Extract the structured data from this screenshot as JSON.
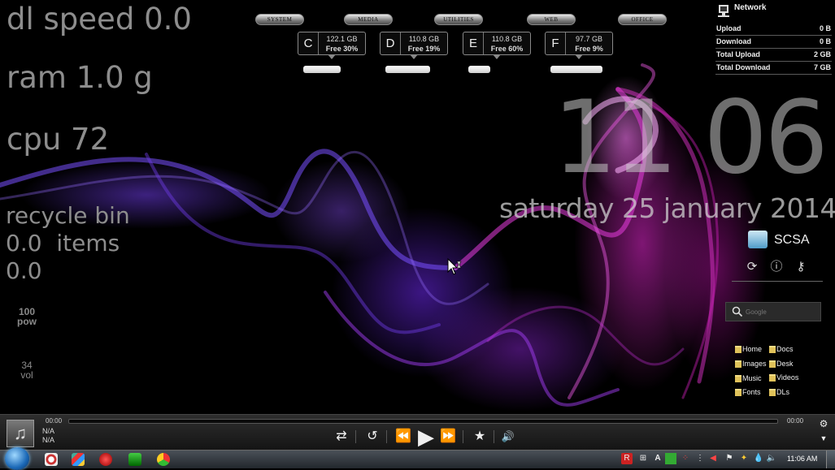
{
  "stats": {
    "dl_speed": "dl speed 0.0",
    "ram": "ram 1.0 g",
    "cpu": "cpu 72",
    "recycle_title": "recycle bin",
    "recycle_items": "0.0  items",
    "recycle_size": "0.0",
    "pow_value": "100",
    "pow_label": "pow",
    "vol_value": "34",
    "vol_label": "vol"
  },
  "tabs": [
    "SYSTEM",
    "MEDIA",
    "UTILITIES",
    "WEB",
    "OFFICE"
  ],
  "drives": [
    {
      "letter": "C",
      "size": "122.1 GB",
      "free": "Free 30%",
      "used_fraction": 0.7
    },
    {
      "letter": "D",
      "size": "110.8 GB",
      "free": "Free 19%",
      "used_fraction": 0.81
    },
    {
      "letter": "E",
      "size": "110.8 GB",
      "free": "Free 60%",
      "used_fraction": 0.4
    },
    {
      "letter": "F",
      "size": "97.7 GB",
      "free": "Free 9%",
      "used_fraction": 0.91
    }
  ],
  "network": {
    "title": "Network",
    "rows": [
      {
        "label": "Upload",
        "value": "0 B"
      },
      {
        "label": "Download",
        "value": "0 B"
      },
      {
        "label": "Total Upload",
        "value": "2 GB"
      },
      {
        "label": "Total Download",
        "value": "7 GB"
      }
    ]
  },
  "clock": {
    "time": "11 06",
    "date": "saturday 25 january 2014"
  },
  "scsa": {
    "label": "SCSA",
    "icons": [
      "refresh-icon",
      "info-icon",
      "key-icon"
    ]
  },
  "search": {
    "placeholder": "Google"
  },
  "folders": [
    "Home",
    "Docs",
    "Images",
    "Desk",
    "Music",
    "Videos",
    "Fonts",
    "DLs"
  ],
  "player": {
    "time_start": "00:00",
    "time_end": "00:00",
    "artist": "N/A",
    "track": "N/A",
    "progress": 0
  },
  "taskbar": {
    "time": "11:06 AM",
    "language": "A"
  }
}
